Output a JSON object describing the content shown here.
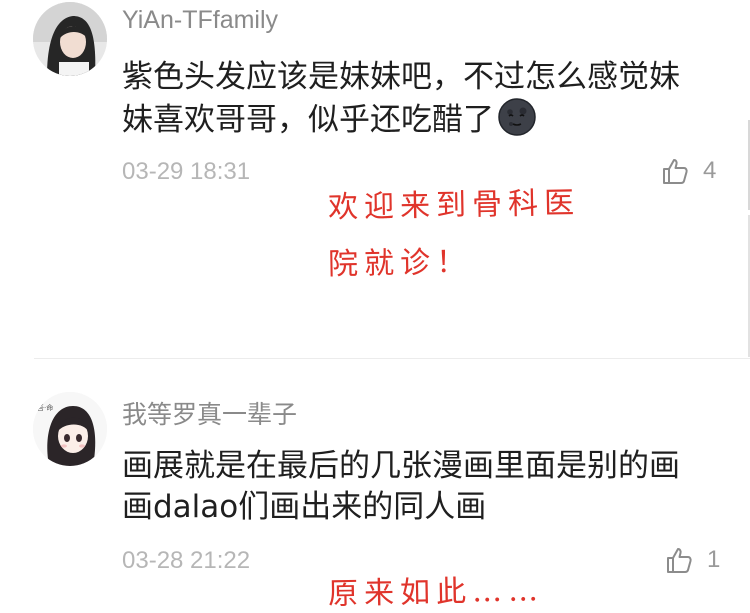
{
  "comments": [
    {
      "username": "YiAn-TFfamily",
      "text_line1": "紫色头发应该是妹妹吧，不过怎么感觉妹",
      "text_line2": "妹喜欢哥哥，似乎还吃醋了",
      "emoji": "new-moon-face-icon",
      "timestamp": "03-29 18:31",
      "likes": "4"
    },
    {
      "username": "我等罗真一辈子",
      "text_line1": "画展就是在最后的几张漫画里面是别的画",
      "text_line2": "画dalao们画出来的同人画",
      "timestamp": "03-28 21:22",
      "likes": "1"
    }
  ],
  "annotations": {
    "first_line1": "欢迎来到骨科医",
    "first_line2": "院就诊！",
    "second_partial": "原来如此……"
  },
  "colors": {
    "annotation": "#e0342b",
    "username": "#8a8a8a",
    "timestamp": "#b6b6b6"
  }
}
